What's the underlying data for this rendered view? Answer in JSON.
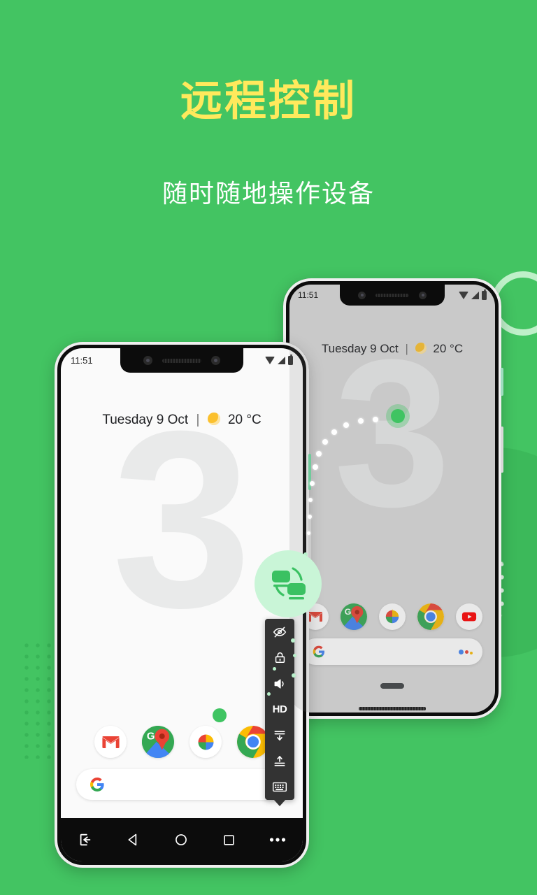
{
  "theme": {
    "background": "#43c462",
    "headline_color": "#ffe95c",
    "subhead_color": "#ffffff",
    "accent_green": "#3fc462",
    "badge_bg": "#c9f5d7",
    "toolbar_bg": "#333333"
  },
  "promo": {
    "headline": "远程控制",
    "subhead": "随时随地操作设备"
  },
  "front_phone": {
    "status": {
      "time": "11:51",
      "icons": [
        "wifi-icon",
        "signal-icon",
        "battery-icon"
      ]
    },
    "weather_widget": {
      "date": "Tuesday 9 Oct",
      "separator": "|",
      "condition_icon": "sun-icon",
      "temperature": "20 °C"
    },
    "wallpaper_glyph": "3",
    "dock": [
      {
        "name": "gmail",
        "label": "Gmail"
      },
      {
        "name": "maps",
        "label": "Maps"
      },
      {
        "name": "photos",
        "label": "Photos"
      },
      {
        "name": "chrome",
        "label": "Chrome"
      }
    ],
    "search_bar": {
      "logo": "google-g-icon",
      "placeholder": ""
    },
    "navbar": [
      {
        "name": "exit",
        "icon": "exit-icon"
      },
      {
        "name": "back",
        "icon": "back-triangle-icon"
      },
      {
        "name": "home",
        "icon": "home-circle-icon"
      },
      {
        "name": "recents",
        "icon": "recents-square-icon"
      },
      {
        "name": "more",
        "icon": "more-dots-icon"
      }
    ]
  },
  "back_phone": {
    "status": {
      "time": "11:51",
      "icons": [
        "wifi-icon",
        "signal-icon",
        "battery-icon"
      ]
    },
    "weather_widget": {
      "date": "Tuesday 9 Oct",
      "separator": "|",
      "condition_icon": "sun-icon",
      "temperature": "20 °C"
    },
    "wallpaper_glyph": "3",
    "dock": [
      {
        "name": "gmail",
        "label": "Gmail"
      },
      {
        "name": "maps",
        "label": "Maps"
      },
      {
        "name": "photos",
        "label": "Photos"
      },
      {
        "name": "chrome",
        "label": "Chrome"
      },
      {
        "name": "youtube",
        "label": "YouTube"
      }
    ],
    "search_bar": {
      "logo": "google-g-icon",
      "assistant_icon": "assistant-dots-icon"
    }
  },
  "remote_toolbar": {
    "badge_icon": "screen-share-icon",
    "items": [
      {
        "name": "privacy-screen",
        "icon": "eye-off-icon",
        "label": ""
      },
      {
        "name": "lock-screen",
        "icon": "lock-icon",
        "label": ""
      },
      {
        "name": "audio",
        "icon": "speaker-icon",
        "label": ""
      },
      {
        "name": "quality",
        "icon": "hd-icon",
        "label": "HD"
      },
      {
        "name": "download",
        "icon": "download-icon",
        "label": ""
      },
      {
        "name": "upload",
        "icon": "upload-icon",
        "label": ""
      },
      {
        "name": "keyboard",
        "icon": "keyboard-icon",
        "label": ""
      }
    ]
  }
}
